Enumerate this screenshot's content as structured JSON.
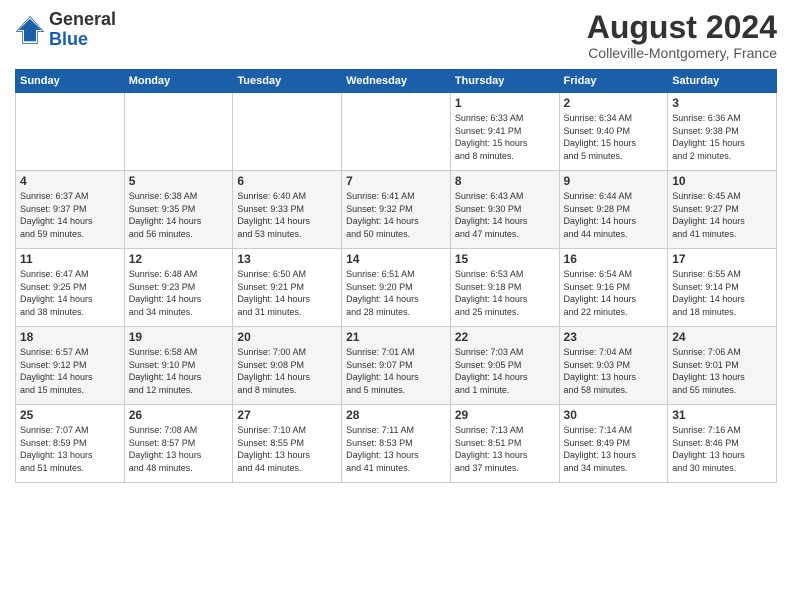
{
  "logo": {
    "general": "General",
    "blue": "Blue"
  },
  "header": {
    "month": "August 2024",
    "location": "Colleville-Montgomery, France"
  },
  "weekdays": [
    "Sunday",
    "Monday",
    "Tuesday",
    "Wednesday",
    "Thursday",
    "Friday",
    "Saturday"
  ],
  "weeks": [
    [
      {
        "day": "",
        "info": ""
      },
      {
        "day": "",
        "info": ""
      },
      {
        "day": "",
        "info": ""
      },
      {
        "day": "",
        "info": ""
      },
      {
        "day": "1",
        "info": "Sunrise: 6:33 AM\nSunset: 9:41 PM\nDaylight: 15 hours\nand 8 minutes."
      },
      {
        "day": "2",
        "info": "Sunrise: 6:34 AM\nSunset: 9:40 PM\nDaylight: 15 hours\nand 5 minutes."
      },
      {
        "day": "3",
        "info": "Sunrise: 6:36 AM\nSunset: 9:38 PM\nDaylight: 15 hours\nand 2 minutes."
      }
    ],
    [
      {
        "day": "4",
        "info": "Sunrise: 6:37 AM\nSunset: 9:37 PM\nDaylight: 14 hours\nand 59 minutes."
      },
      {
        "day": "5",
        "info": "Sunrise: 6:38 AM\nSunset: 9:35 PM\nDaylight: 14 hours\nand 56 minutes."
      },
      {
        "day": "6",
        "info": "Sunrise: 6:40 AM\nSunset: 9:33 PM\nDaylight: 14 hours\nand 53 minutes."
      },
      {
        "day": "7",
        "info": "Sunrise: 6:41 AM\nSunset: 9:32 PM\nDaylight: 14 hours\nand 50 minutes."
      },
      {
        "day": "8",
        "info": "Sunrise: 6:43 AM\nSunset: 9:30 PM\nDaylight: 14 hours\nand 47 minutes."
      },
      {
        "day": "9",
        "info": "Sunrise: 6:44 AM\nSunset: 9:28 PM\nDaylight: 14 hours\nand 44 minutes."
      },
      {
        "day": "10",
        "info": "Sunrise: 6:45 AM\nSunset: 9:27 PM\nDaylight: 14 hours\nand 41 minutes."
      }
    ],
    [
      {
        "day": "11",
        "info": "Sunrise: 6:47 AM\nSunset: 9:25 PM\nDaylight: 14 hours\nand 38 minutes."
      },
      {
        "day": "12",
        "info": "Sunrise: 6:48 AM\nSunset: 9:23 PM\nDaylight: 14 hours\nand 34 minutes."
      },
      {
        "day": "13",
        "info": "Sunrise: 6:50 AM\nSunset: 9:21 PM\nDaylight: 14 hours\nand 31 minutes."
      },
      {
        "day": "14",
        "info": "Sunrise: 6:51 AM\nSunset: 9:20 PM\nDaylight: 14 hours\nand 28 minutes."
      },
      {
        "day": "15",
        "info": "Sunrise: 6:53 AM\nSunset: 9:18 PM\nDaylight: 14 hours\nand 25 minutes."
      },
      {
        "day": "16",
        "info": "Sunrise: 6:54 AM\nSunset: 9:16 PM\nDaylight: 14 hours\nand 22 minutes."
      },
      {
        "day": "17",
        "info": "Sunrise: 6:55 AM\nSunset: 9:14 PM\nDaylight: 14 hours\nand 18 minutes."
      }
    ],
    [
      {
        "day": "18",
        "info": "Sunrise: 6:57 AM\nSunset: 9:12 PM\nDaylight: 14 hours\nand 15 minutes."
      },
      {
        "day": "19",
        "info": "Sunrise: 6:58 AM\nSunset: 9:10 PM\nDaylight: 14 hours\nand 12 minutes."
      },
      {
        "day": "20",
        "info": "Sunrise: 7:00 AM\nSunset: 9:08 PM\nDaylight: 14 hours\nand 8 minutes."
      },
      {
        "day": "21",
        "info": "Sunrise: 7:01 AM\nSunset: 9:07 PM\nDaylight: 14 hours\nand 5 minutes."
      },
      {
        "day": "22",
        "info": "Sunrise: 7:03 AM\nSunset: 9:05 PM\nDaylight: 14 hours\nand 1 minute."
      },
      {
        "day": "23",
        "info": "Sunrise: 7:04 AM\nSunset: 9:03 PM\nDaylight: 13 hours\nand 58 minutes."
      },
      {
        "day": "24",
        "info": "Sunrise: 7:06 AM\nSunset: 9:01 PM\nDaylight: 13 hours\nand 55 minutes."
      }
    ],
    [
      {
        "day": "25",
        "info": "Sunrise: 7:07 AM\nSunset: 8:59 PM\nDaylight: 13 hours\nand 51 minutes."
      },
      {
        "day": "26",
        "info": "Sunrise: 7:08 AM\nSunset: 8:57 PM\nDaylight: 13 hours\nand 48 minutes."
      },
      {
        "day": "27",
        "info": "Sunrise: 7:10 AM\nSunset: 8:55 PM\nDaylight: 13 hours\nand 44 minutes."
      },
      {
        "day": "28",
        "info": "Sunrise: 7:11 AM\nSunset: 8:53 PM\nDaylight: 13 hours\nand 41 minutes."
      },
      {
        "day": "29",
        "info": "Sunrise: 7:13 AM\nSunset: 8:51 PM\nDaylight: 13 hours\nand 37 minutes."
      },
      {
        "day": "30",
        "info": "Sunrise: 7:14 AM\nSunset: 8:49 PM\nDaylight: 13 hours\nand 34 minutes."
      },
      {
        "day": "31",
        "info": "Sunrise: 7:16 AM\nSunset: 8:46 PM\nDaylight: 13 hours\nand 30 minutes."
      }
    ]
  ]
}
